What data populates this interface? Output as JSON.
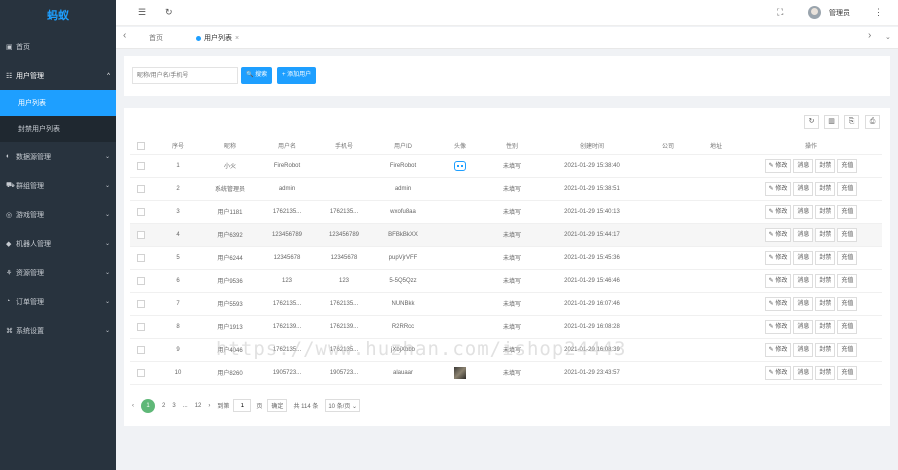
{
  "sidebar": {
    "logo": "蚂蚁",
    "items": [
      {
        "icon": "home-icon",
        "glyph": "▣",
        "label": "首页"
      },
      {
        "icon": "user-icon",
        "glyph": "☷",
        "label": "用户管理",
        "chev": "^"
      },
      {
        "icon": "chart-icon",
        "glyph": "◐",
        "label": "数据源管理",
        "chev": "⌄"
      },
      {
        "icon": "cart-icon",
        "glyph": "⛟",
        "label": "群组管理",
        "chev": "⌄"
      },
      {
        "icon": "game-icon",
        "glyph": "◎",
        "label": "游戏管理",
        "chev": "⌄"
      },
      {
        "icon": "robot-nav-icon",
        "glyph": "◆",
        "label": "机器人管理",
        "chev": "⌄"
      },
      {
        "icon": "resource-icon",
        "glyph": "⚘",
        "label": "资源管理",
        "chev": "⌄"
      },
      {
        "icon": "order-icon",
        "glyph": "◔",
        "label": "订单管理",
        "chev": "⌄"
      },
      {
        "icon": "settings-icon",
        "glyph": "⌘",
        "label": "系统设置",
        "chev": "⌄"
      }
    ],
    "sub_items": [
      "用户列表",
      "封禁用户列表"
    ]
  },
  "topbar": {
    "menu_glyph": "☰",
    "refresh_glyph": "↻",
    "fullscreen_glyph": "⛶",
    "username": "管理员",
    "more_glyph": "⋮"
  },
  "tabs": {
    "prev": "‹",
    "home": "首页",
    "current": "用户列表",
    "close": "×",
    "next": "›",
    "dropdown": "⌄"
  },
  "search": {
    "placeholder": "昵称/用户名/手机号",
    "search_label": "🔍 搜索",
    "add_label": "+ 添加用户"
  },
  "toolbar": {
    "refresh": "↻",
    "columns": "▥",
    "export": "⎘",
    "print": "⎙"
  },
  "table": {
    "columns": [
      "",
      "序号",
      "昵称",
      "用户名",
      "手机号",
      "用户ID",
      "头像",
      "性别",
      "创建时间",
      "公司",
      "地址",
      "操作"
    ],
    "rows": [
      {
        "no": "1",
        "nick": "小火",
        "user": "FireRobot",
        "phone": "",
        "uid": "FireRobot",
        "avatar": "robot",
        "sex": "未填写",
        "time": "2021-01-29 15:38:40"
      },
      {
        "no": "2",
        "nick": "系统管理员",
        "user": "admin",
        "phone": "",
        "uid": "admin",
        "avatar": "",
        "sex": "未填写",
        "time": "2021-01-29 15:38:51"
      },
      {
        "no": "3",
        "nick": "用户1181",
        "user": "1762135...",
        "phone": "1762135...",
        "uid": "wxofu8aa",
        "avatar": "",
        "sex": "未填写",
        "time": "2021-01-29 15:40:13"
      },
      {
        "no": "4",
        "nick": "用户6392",
        "user": "123456789",
        "phone": "123456789",
        "uid": "BFBkBkXX",
        "avatar": "",
        "sex": "未填写",
        "time": "2021-01-29 15:44:17"
      },
      {
        "no": "5",
        "nick": "用户6244",
        "user": "12345678",
        "phone": "12345678",
        "uid": "pupVjrVFF",
        "avatar": "",
        "sex": "未填写",
        "time": "2021-01-29 15:45:36"
      },
      {
        "no": "6",
        "nick": "用户9536",
        "user": "123",
        "phone": "123",
        "uid": "5-5Q5Qzz",
        "avatar": "",
        "sex": "未填写",
        "time": "2021-01-29 15:46:46"
      },
      {
        "no": "7",
        "nick": "用户5593",
        "user": "1762135...",
        "phone": "1762135...",
        "uid": "NUNBkk",
        "avatar": "",
        "sex": "未填写",
        "time": "2021-01-29 16:07:46"
      },
      {
        "no": "8",
        "nick": "用户1913",
        "user": "1762139...",
        "phone": "1762139...",
        "uid": "R2RRcc",
        "avatar": "",
        "sex": "未填写",
        "time": "2021-01-29 16:08:28"
      },
      {
        "no": "9",
        "nick": "用户4046",
        "user": "1762135...",
        "phone": "1762135...",
        "uid": "jXbjXbbb",
        "avatar": "",
        "sex": "未填写",
        "time": "2021-01-29 16:08:39"
      },
      {
        "no": "10",
        "nick": "用户8260",
        "user": "1905723...",
        "phone": "1905723...",
        "uid": "alauaar",
        "avatar": "photo",
        "sex": "未填写",
        "time": "2021-01-29 23:43:57"
      }
    ],
    "ops": [
      "✎ 修改",
      "消息",
      "封禁",
      "充值"
    ]
  },
  "pager": {
    "prev": "‹",
    "pages": [
      "1",
      "2",
      "3",
      "...",
      "12"
    ],
    "next": "›",
    "goto_label": "到第",
    "goto_value": "1",
    "page_unit": "页",
    "confirm": "确定",
    "total": "共 114 条",
    "page_size": "10 条/页 ⌄"
  },
  "watermark": "https://www.huzhan.com/ishop24443"
}
